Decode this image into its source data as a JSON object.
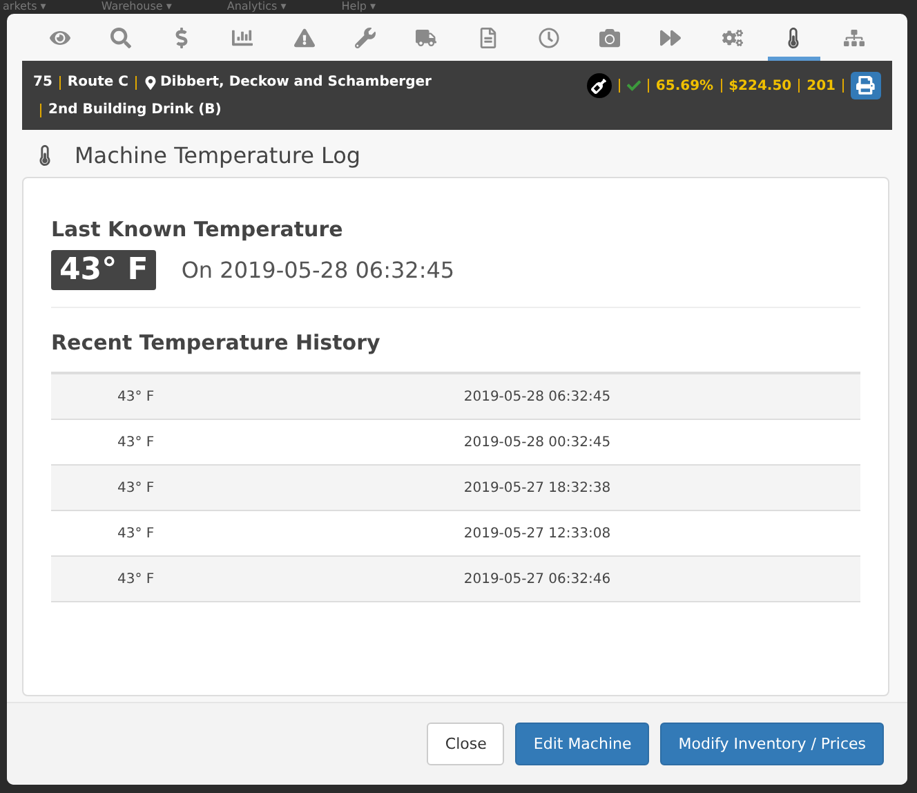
{
  "background_menu": [
    "arkets ▾",
    "Warehouse ▾",
    "Analytics ▾",
    "Help ▾"
  ],
  "tabs": [
    {
      "selected": false
    },
    {
      "selected": false
    },
    {
      "selected": false
    },
    {
      "selected": false
    },
    {
      "selected": false
    },
    {
      "selected": false
    },
    {
      "selected": false
    },
    {
      "selected": false
    },
    {
      "selected": false
    },
    {
      "selected": false
    },
    {
      "selected": false
    },
    {
      "selected": false
    },
    {
      "selected": true
    },
    {
      "selected": false
    }
  ],
  "info_bar": {
    "left": [
      {
        "text": "75",
        "kind": "plain"
      },
      {
        "text": "Route C",
        "kind": "plain"
      },
      {
        "text": "Dibbert, Deckow and Schamberger",
        "kind": "location"
      },
      {
        "text": "2nd Building Drink (B)",
        "kind": "plain"
      }
    ],
    "status_ok": true,
    "stats": [
      "65.69%",
      "$224.50",
      "201"
    ]
  },
  "title": "Machine Temperature Log",
  "last_known": {
    "heading": "Last Known Temperature",
    "value": "43° F",
    "timestamp": "On 2019-05-28 06:32:45"
  },
  "history": {
    "heading": "Recent Temperature History",
    "rows": [
      {
        "column_1": "43° F",
        "column_2": "2019-05-28 06:32:45"
      },
      {
        "column_1": "43° F",
        "column_2": "2019-05-28 00:32:45"
      },
      {
        "column_1": "43° F",
        "column_2": "2019-05-27 18:32:38"
      },
      {
        "column_1": "43° F",
        "column_2": "2019-05-27 12:33:08"
      },
      {
        "column_1": "43° F",
        "column_2": "2019-05-27 06:32:46"
      }
    ]
  },
  "footer_buttons": [
    {
      "label": "Close",
      "kind": "default"
    },
    {
      "label": "Edit Machine",
      "kind": "primary"
    },
    {
      "label": "Modify Inventory / Prices",
      "kind": "primary"
    }
  ]
}
